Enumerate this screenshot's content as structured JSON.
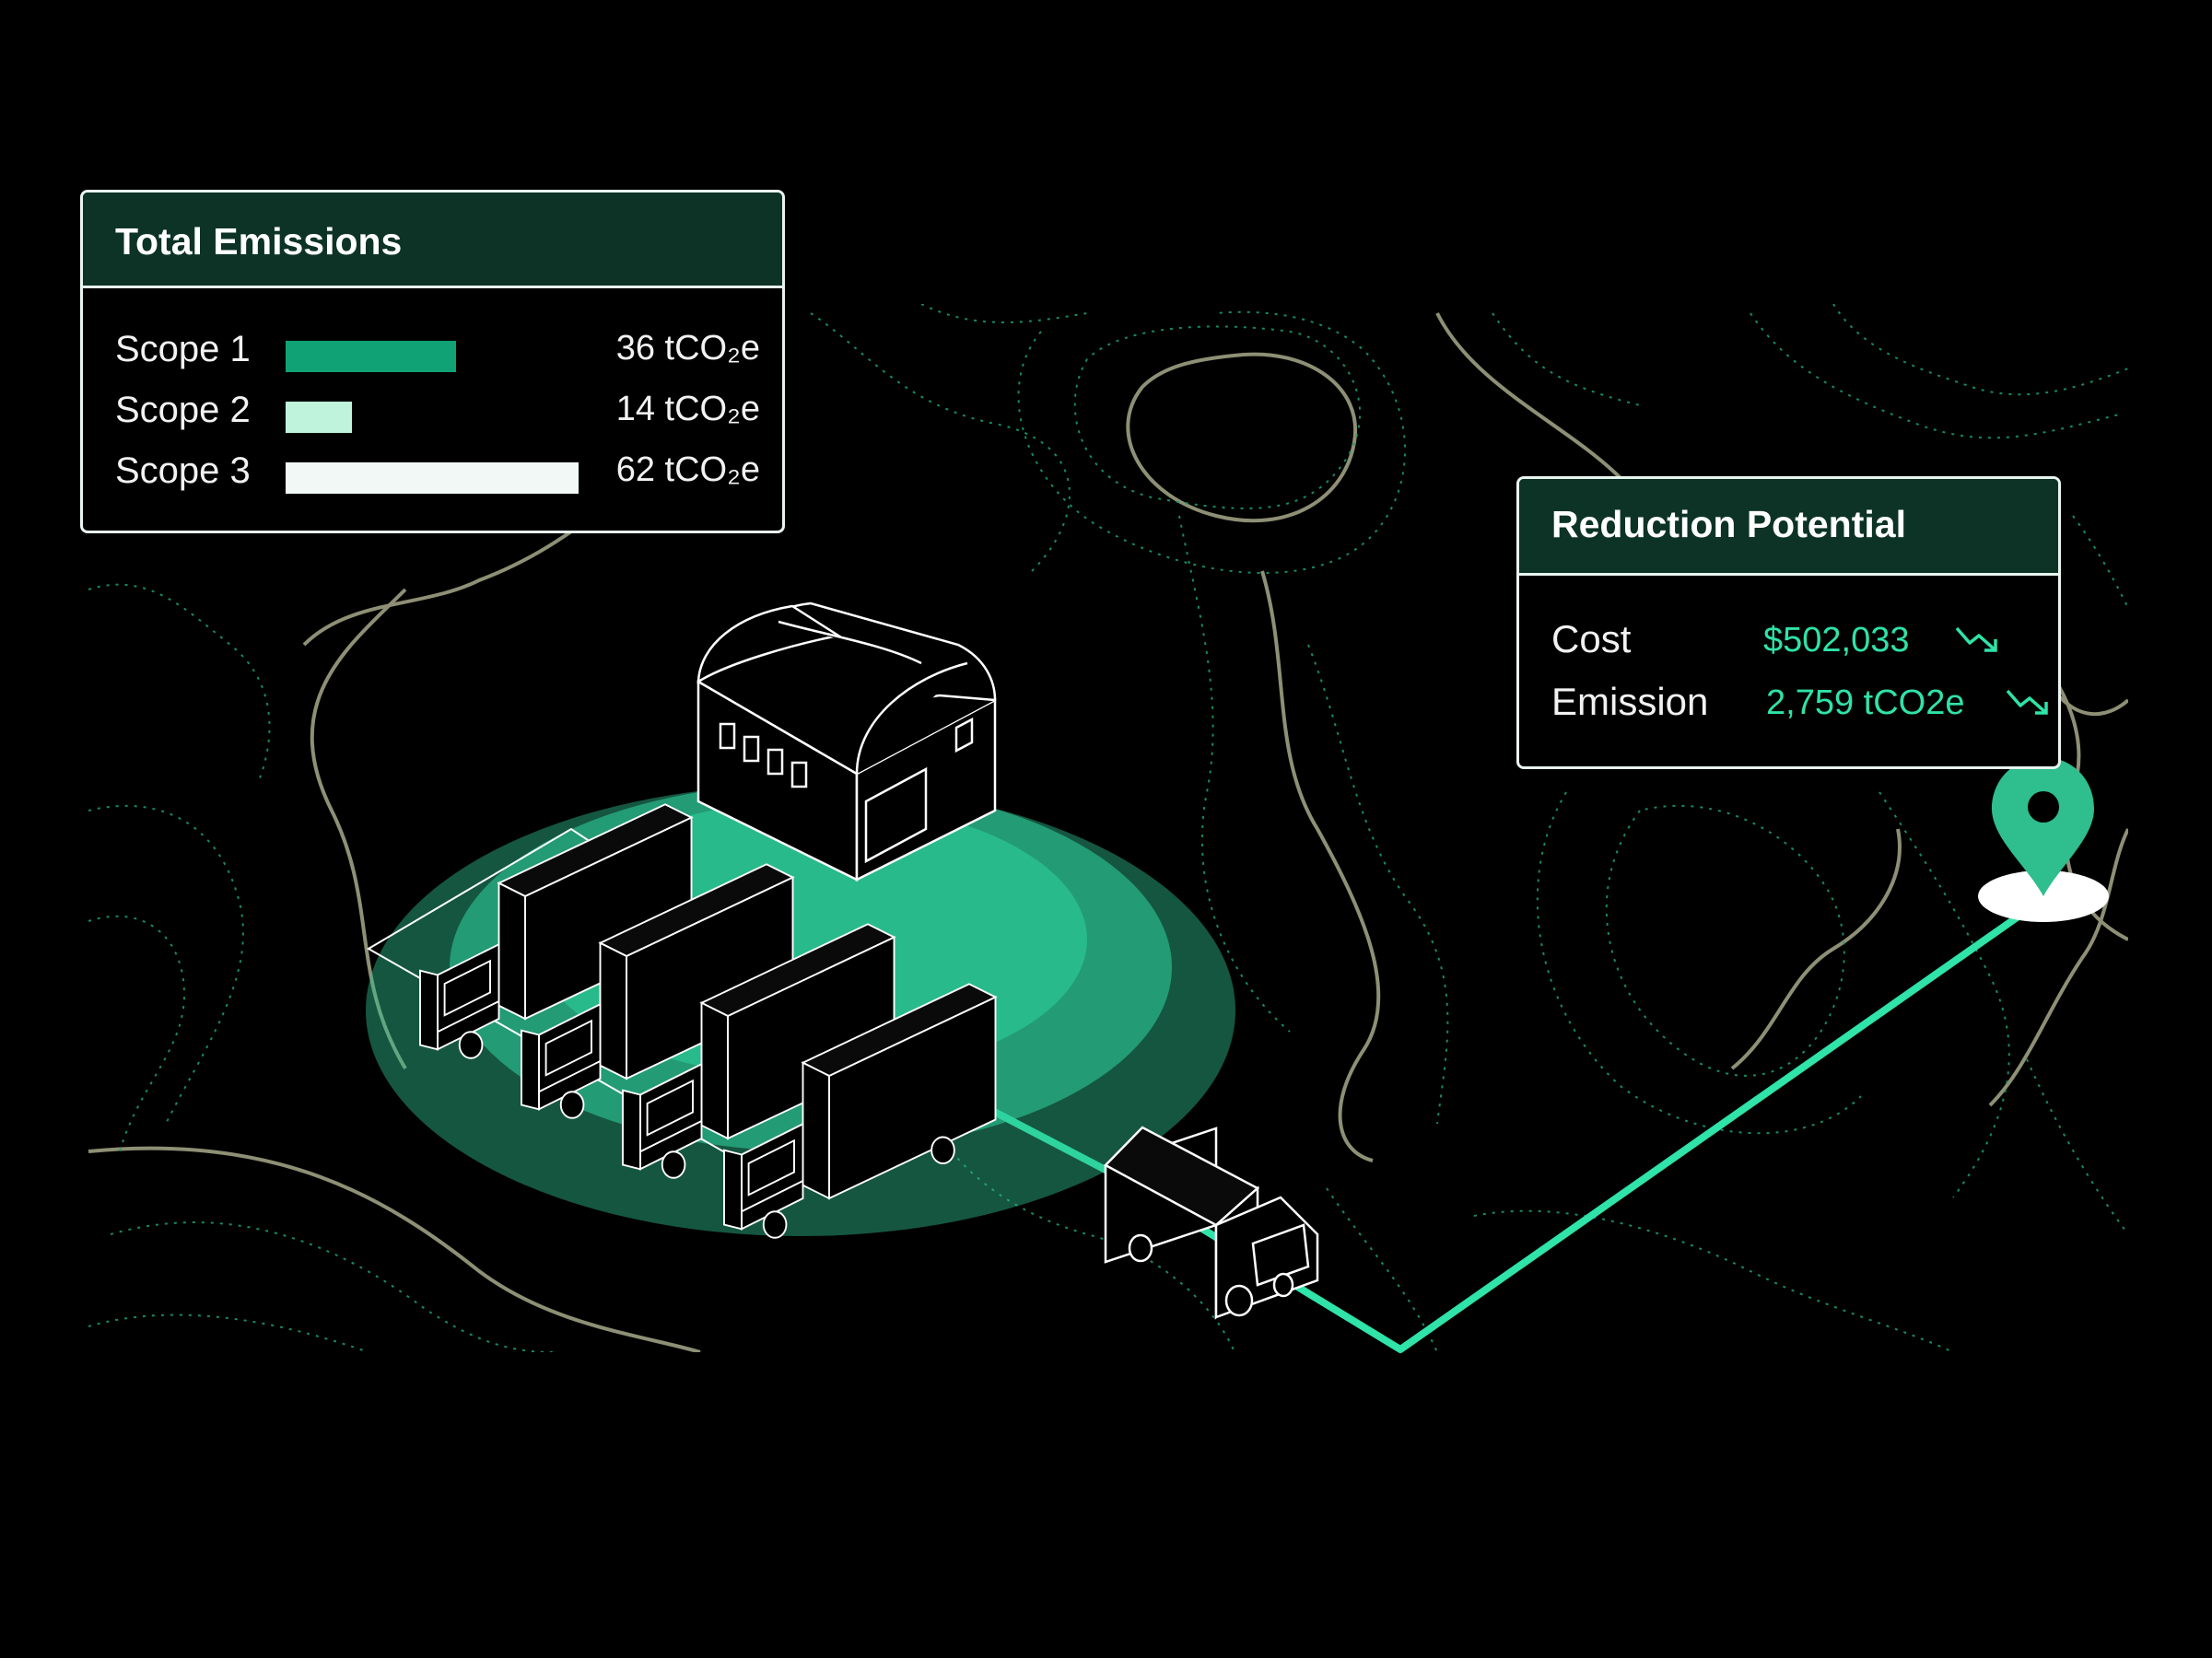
{
  "colors": {
    "background": "#000000",
    "panel_header": "#0d3327",
    "accent": "#2fe3a9",
    "scope1": "#10a275",
    "scope2": "#bff3dc",
    "scope3": "#f1f8f5",
    "contour_green": "#1a9a6e",
    "contour_olive": "#a7a98a"
  },
  "emissions": {
    "title": "Total Emissions",
    "scopes": [
      {
        "label": "Scope 1",
        "value": "36 tCO₂e",
        "amount": 36
      },
      {
        "label": "Scope 2",
        "value": "14 tCO₂e",
        "amount": 14
      },
      {
        "label": "Scope 3",
        "value": "62 tCO₂e",
        "amount": 62
      }
    ]
  },
  "reduction": {
    "title": "Reduction Potential",
    "rows": [
      {
        "label": "Cost",
        "value": "$502,033",
        "trend_icon": "trend-down-icon"
      },
      {
        "label": "Emission",
        "value": "2,759 tCO2e",
        "trend_icon": "trend-down-icon"
      }
    ]
  },
  "illustration": {
    "depot_trucks": 4,
    "route_trucks": 1,
    "icons": [
      "warehouse-icon",
      "truck-icon",
      "location-pin-icon"
    ]
  }
}
